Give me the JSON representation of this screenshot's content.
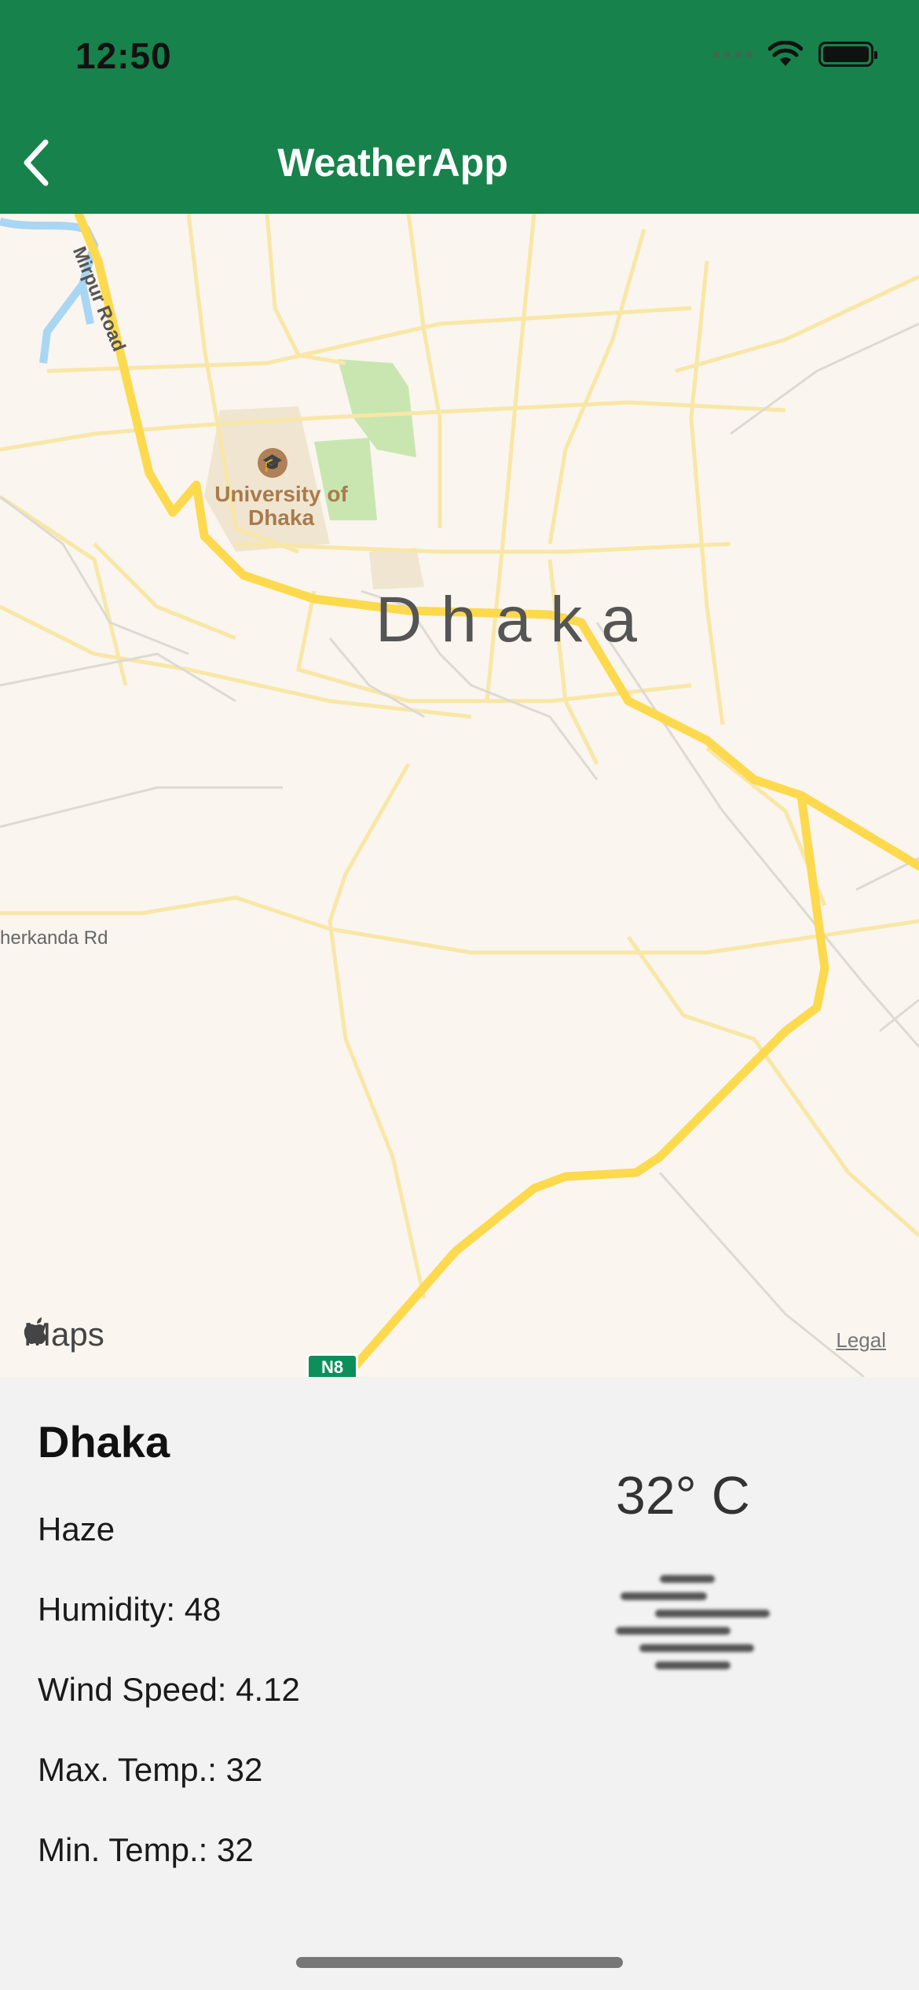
{
  "status_bar": {
    "time": "12:50"
  },
  "nav": {
    "title": "WeatherApp",
    "back_icon": "chevron-left-icon"
  },
  "map": {
    "city_label": "Dhaka",
    "poi_label": "University of Dhaka",
    "road_labels": [
      "Mirpur Road",
      "herkanda Rd"
    ],
    "highway_shield": "N8",
    "provider": "Maps",
    "legal": "Legal",
    "colors": {
      "land": "#faf5ee",
      "major_road": "#fdd94e",
      "minor_road": "#f8e7a6",
      "park": "#c9e6b1",
      "water": "#a9d6f2"
    }
  },
  "weather": {
    "city": "Dhaka",
    "condition": "Haze",
    "humidity": "Humidity: 48",
    "wind_speed": "Wind Speed: 4.12",
    "max_temp": "Max. Temp.: 32",
    "min_temp": "Min. Temp.: 32",
    "temperature": "32° C",
    "icon": "haze-icon"
  },
  "colors": {
    "header": "#17824b",
    "panel": "#f2f2f2"
  }
}
